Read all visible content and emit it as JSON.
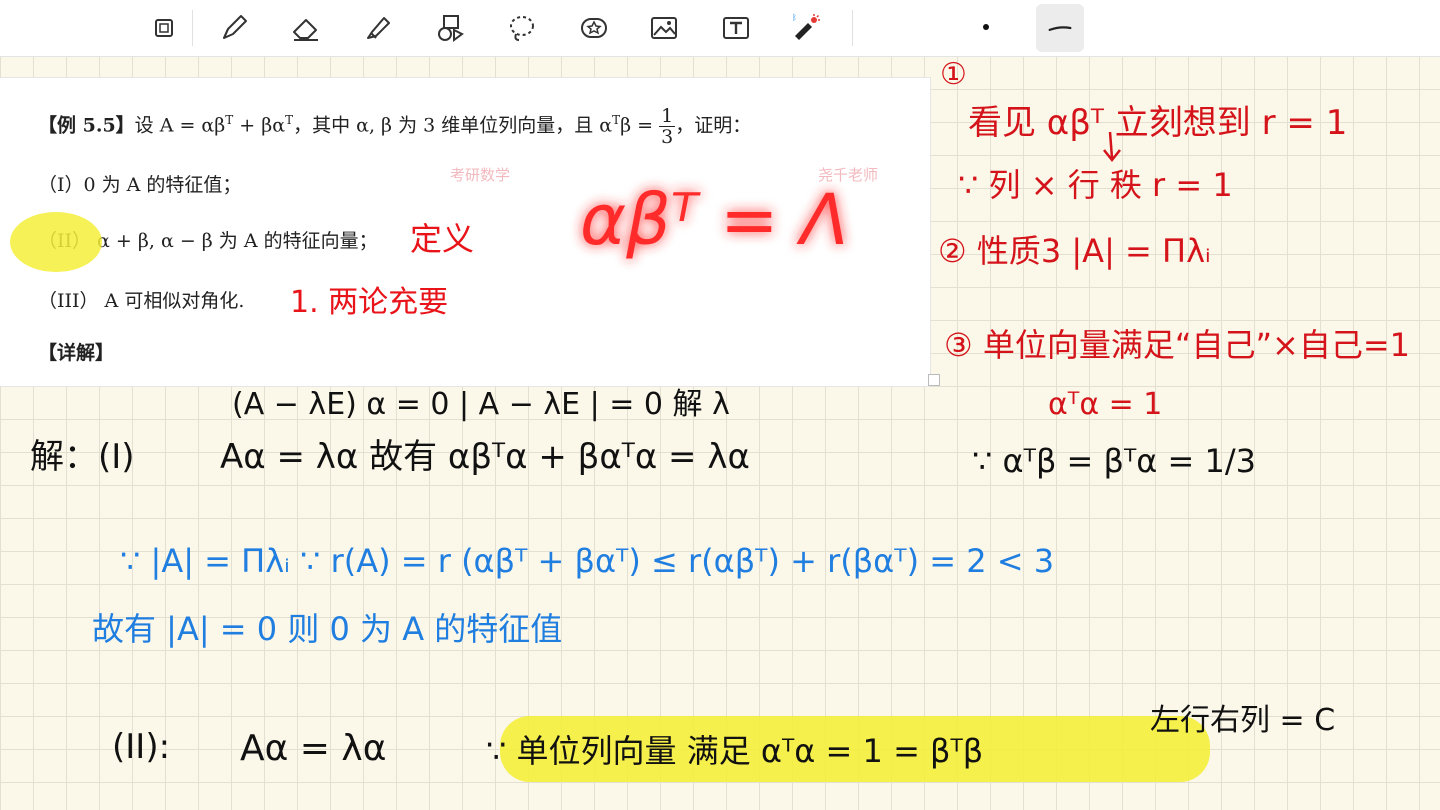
{
  "toolbar": {
    "tools": [
      {
        "name": "lasso-select"
      },
      {
        "name": "pen"
      },
      {
        "name": "eraser"
      },
      {
        "name": "highlighter"
      },
      {
        "name": "shapes"
      },
      {
        "name": "lasso"
      },
      {
        "name": "sticker"
      },
      {
        "name": "image"
      },
      {
        "name": "text"
      },
      {
        "name": "laser-pointer"
      }
    ]
  },
  "document": {
    "example_label": "【例 5.5】",
    "problem_intro": "设 A = αβ",
    "problem_rest": "，其中 α, β 为 3 维单位列向量，且 α",
    "problem_end": "，证明：",
    "fraction_num": "1",
    "fraction_den": "3",
    "part1": "（I）0 为 A 的特征值；",
    "part2": "（II） α + β, α − β 为 A 的特征向量；",
    "part3": "（III） A 可相似对角化.",
    "solution_label": "【详解】",
    "watermark_right": "尧千老师"
  },
  "annotations": {
    "red_big": "αβᵀ = Λ",
    "red_def": "定义",
    "red_part3": "1. 两论充要",
    "red_note1_num": "①",
    "red_note1": "看见 αβᵀ 立刻想到 r = 1",
    "red_note1b": "∵ 列 × 行 秩 r = 1",
    "red_note2": "② 性质3   |A| = Πλᵢ",
    "red_note3": "③ 单位向量满足“自己”×自己=1",
    "red_note3b": "αᵀα = 1",
    "black_top": "(A − λE) α = 0       | A − λE | = 0  解 λ",
    "black_sol1_label": "解：(I)",
    "black_sol1": "Aα = λα    故有    αβᵀα + βαᵀα = λα",
    "black_sol1_right": "∵ αᵀβ = βᵀα = 1/3",
    "blue_line1": "∵  |A| = Πλᵢ      ∵  r(A) = r (αβᵀ + βαᵀ) ≤ r(αβᵀ) + r(βαᵀ) = 2 < 3",
    "blue_line2": "故有  |A| = 0    则  0 为 A 的特征值",
    "black_sol2_label": "(II):",
    "black_sol2": "Aα = λα",
    "black_sol2_hl": "∵ 单位列向量  满足 αᵀα = 1 = βᵀβ",
    "black_sol2_right": "左行右列 = C"
  }
}
